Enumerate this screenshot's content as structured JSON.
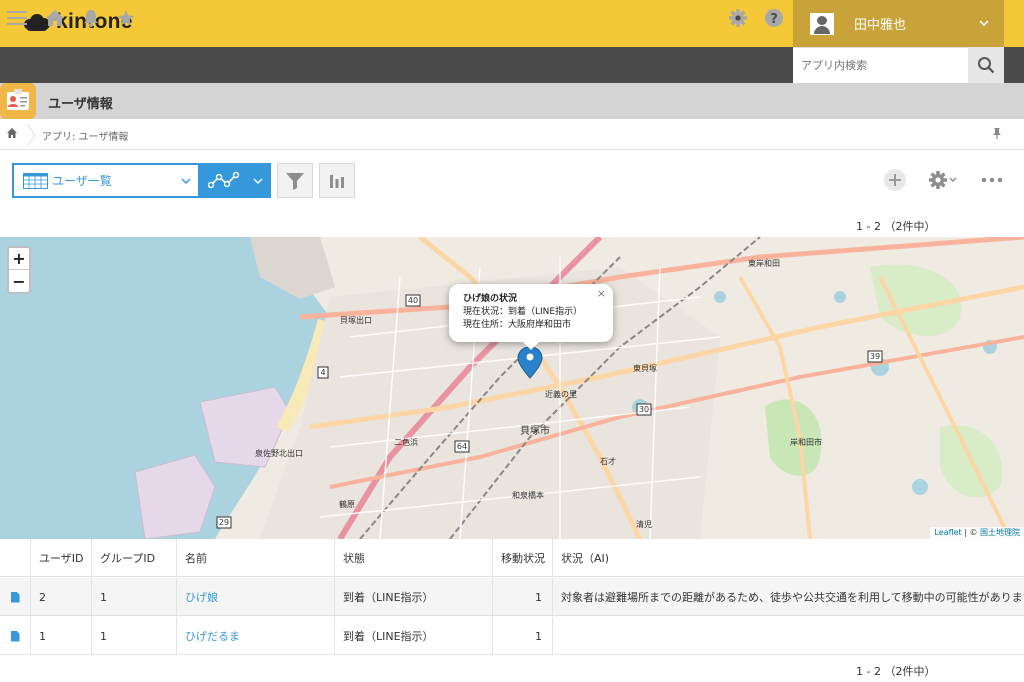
{
  "brand": {
    "logo_text": "kintone"
  },
  "user": {
    "name": "田中雅也"
  },
  "search": {
    "placeholder": "アプリ内検索"
  },
  "app": {
    "title": "ユーザ情報"
  },
  "breadcrumb": {
    "path": "アプリ: ユーザ情報"
  },
  "view": {
    "selected": "ユーザ一覧"
  },
  "pager": {
    "top": "1 - 2 （2件中）",
    "bottom": "1 - 2 （2件中）"
  },
  "map": {
    "popup": {
      "title": "ひげ娘の状況",
      "lines": [
        "現在状況：到着（LINE指示）",
        "現在住所：大阪府岸和田市"
      ]
    },
    "labels": [
      "貝塚市",
      "東岸和田",
      "東貝塚",
      "近義の里",
      "二色浜",
      "鶴原",
      "和泉橋本",
      "清児",
      "岸和田市",
      "石才",
      "貝塚出口",
      "泉佐野北出口"
    ],
    "attribution": {
      "leaflet": "Leaflet",
      "sep": " | © ",
      "source": "国土地理院"
    }
  },
  "table": {
    "headers": [
      "ユーザID",
      "グループID",
      "名前",
      "状態",
      "移動状況",
      "状況（AI)"
    ],
    "rows": [
      {
        "user_id": "2",
        "group_id": "1",
        "name": "ひげ娘",
        "status": "到着（LINE指示）",
        "moving": "1",
        "ai": "対象者は避難場所までの距離があるため、徒歩や公共交通を利用して移動中の可能性があります。"
      },
      {
        "user_id": "1",
        "group_id": "1",
        "name": "ひげだるま",
        "status": "到着（LINE指示）",
        "moving": "1",
        "ai": ""
      }
    ]
  },
  "colors": {
    "topbar": "#f5c838",
    "accent": "#3498db",
    "navbar": "#4b4b4b"
  },
  "icons": [
    "menu-icon",
    "home-icon",
    "bell-icon",
    "star-icon",
    "gear-icon",
    "help-icon",
    "search-icon",
    "pin-icon",
    "filter-icon",
    "graph-icon",
    "plus-icon",
    "more-icon",
    "document-icon",
    "map-marker-icon"
  ]
}
